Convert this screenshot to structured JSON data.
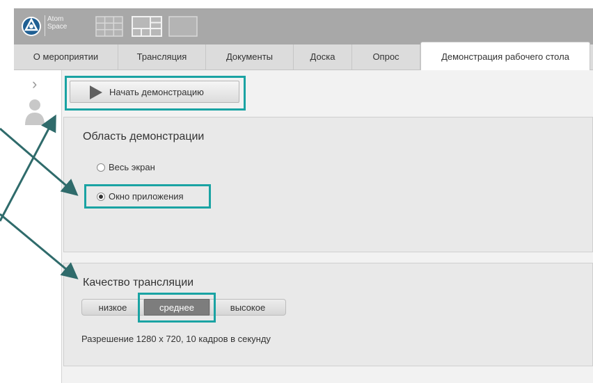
{
  "app": {
    "logo_text_line1": "Atom",
    "logo_text_line2": "Space",
    "logo_icon": "atom-logo-icon",
    "layout_icons": [
      "grid-layout-icon",
      "split-layout-icon",
      "single-layout-icon"
    ]
  },
  "tabs": [
    {
      "label": "О мероприятии",
      "active": false
    },
    {
      "label": "Трансляция",
      "active": false
    },
    {
      "label": "Документы",
      "active": false
    },
    {
      "label": "Доска",
      "active": false
    },
    {
      "label": "Опрос",
      "active": false
    },
    {
      "label": "Демонстрация рабочего стола",
      "active": true
    }
  ],
  "sidebar": {
    "expand_icon": "chevron-right-icon",
    "user_icon": "user-icon"
  },
  "start_button": {
    "label": "Начать демонстрацию",
    "icon": "play-icon"
  },
  "demo_area": {
    "title": "Область демонстрации",
    "options": [
      {
        "label": "Весь экран",
        "selected": false
      },
      {
        "label": "Окно приложения",
        "selected": true
      }
    ]
  },
  "quality": {
    "title": "Качество трансляции",
    "options": [
      {
        "label": "низкое",
        "selected": false
      },
      {
        "label": "среднее",
        "selected": true
      },
      {
        "label": "высокое",
        "selected": false
      }
    ],
    "resolution_text": "Разрешение 1280 x 720, 10 кадров в секунду"
  },
  "colors": {
    "highlight": "#1aa3a3",
    "arrow": "#2f6b6b",
    "topbar": "#a8a8a8",
    "selected_segment": "#7d7d7d"
  }
}
